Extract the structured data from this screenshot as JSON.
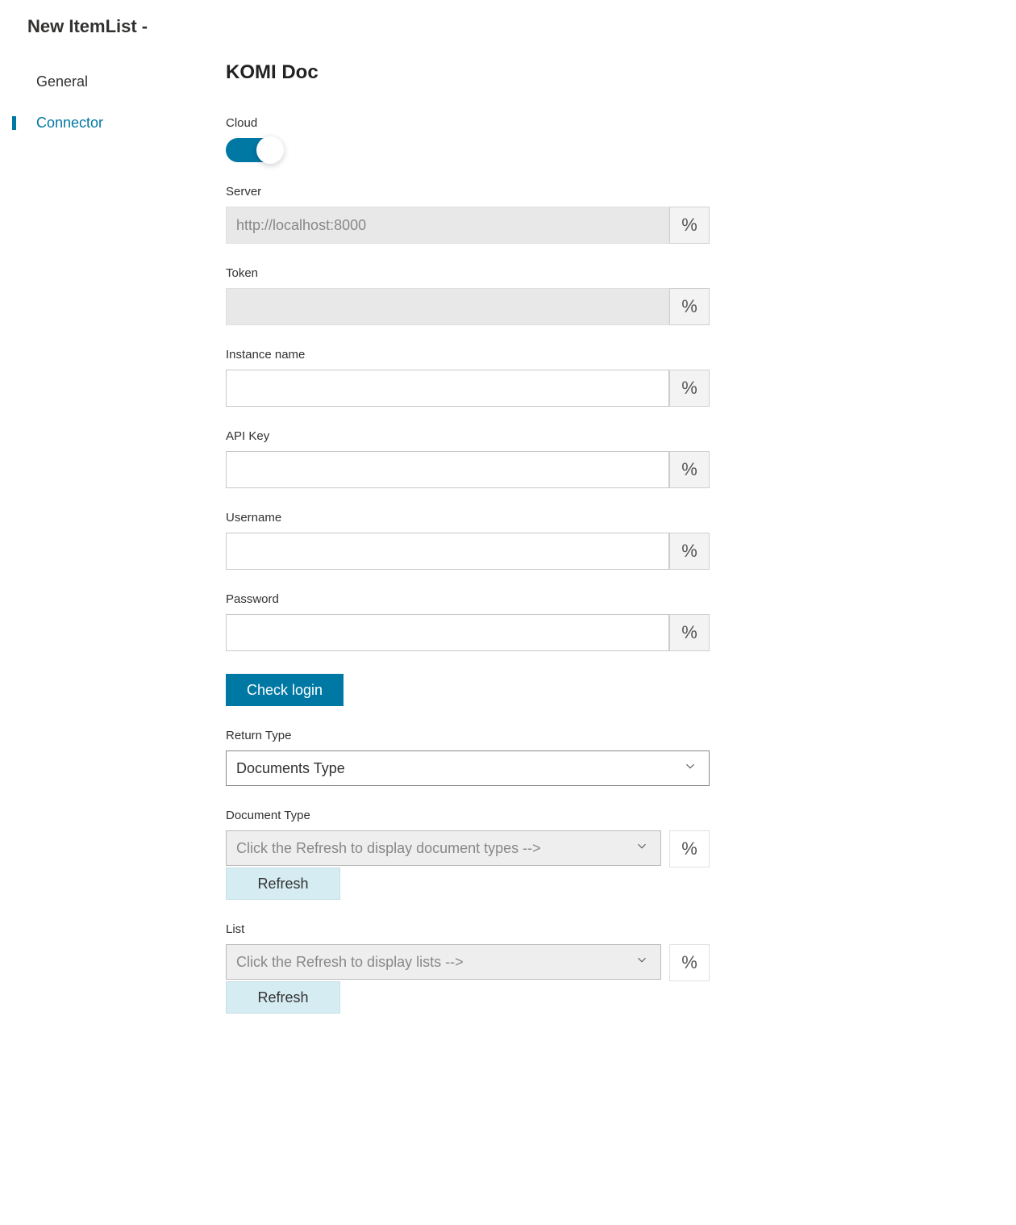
{
  "page_title": "New ItemList -",
  "sidebar": {
    "items": [
      {
        "label": "General",
        "active": false
      },
      {
        "label": "Connector",
        "active": true
      }
    ]
  },
  "main": {
    "section_title": "KOMI Doc",
    "fields": {
      "cloud": {
        "label": "Cloud",
        "value": true
      },
      "server": {
        "label": "Server",
        "placeholder": "http://localhost:8000",
        "value": "",
        "disabled": true
      },
      "token": {
        "label": "Token",
        "value": "",
        "disabled": true
      },
      "instance_name": {
        "label": "Instance name",
        "value": ""
      },
      "api_key": {
        "label": "API Key",
        "value": ""
      },
      "username": {
        "label": "Username",
        "value": ""
      },
      "password": {
        "label": "Password",
        "value": ""
      },
      "check_login_label": "Check login",
      "return_type": {
        "label": "Return Type",
        "value": "Documents Type"
      },
      "document_type": {
        "label": "Document Type",
        "placeholder": "Click the Refresh to display document types -->",
        "refresh_label": "Refresh"
      },
      "list": {
        "label": "List",
        "placeholder": "Click the Refresh to display lists -->",
        "refresh_label": "Refresh"
      }
    },
    "percent_symbol": "%"
  }
}
